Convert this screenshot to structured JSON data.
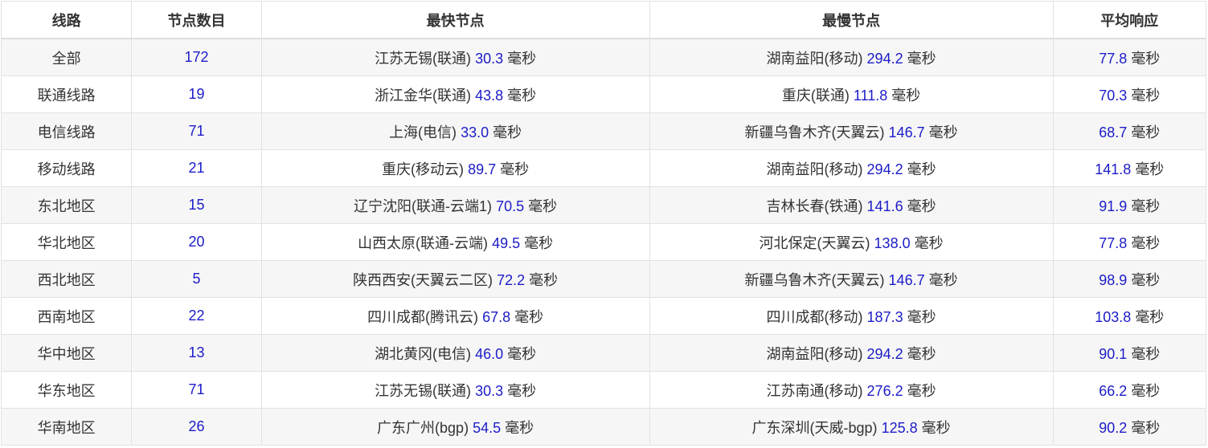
{
  "headers": {
    "line": "线路",
    "count": "节点数目",
    "fastest": "最快节点",
    "slowest": "最慢节点",
    "average": "平均响应"
  },
  "unit": "毫秒",
  "colors": {
    "number": "#1c1cc8",
    "text": "#333333",
    "row_alt": "#f6f6f6",
    "border": "#e2e2e2"
  },
  "rows": [
    {
      "line": "全部",
      "count": "172",
      "fast_name": "江苏无锡(联通)",
      "fast_ms": "30.3",
      "slow_name": "湖南益阳(移动)",
      "slow_ms": "294.2",
      "avg_ms": "77.8"
    },
    {
      "line": "联通线路",
      "count": "19",
      "fast_name": "浙江金华(联通)",
      "fast_ms": "43.8",
      "slow_name": "重庆(联通)",
      "slow_ms": "111.8",
      "avg_ms": "70.3"
    },
    {
      "line": "电信线路",
      "count": "71",
      "fast_name": "上海(电信)",
      "fast_ms": "33.0",
      "slow_name": "新疆乌鲁木齐(天翼云)",
      "slow_ms": "146.7",
      "avg_ms": "68.7"
    },
    {
      "line": "移动线路",
      "count": "21",
      "fast_name": "重庆(移动云)",
      "fast_ms": "89.7",
      "slow_name": "湖南益阳(移动)",
      "slow_ms": "294.2",
      "avg_ms": "141.8"
    },
    {
      "line": "东北地区",
      "count": "15",
      "fast_name": "辽宁沈阳(联通-云端1)",
      "fast_ms": "70.5",
      "slow_name": "吉林长春(铁通)",
      "slow_ms": "141.6",
      "avg_ms": "91.9"
    },
    {
      "line": "华北地区",
      "count": "20",
      "fast_name": "山西太原(联通-云端)",
      "fast_ms": "49.5",
      "slow_name": "河北保定(天翼云)",
      "slow_ms": "138.0",
      "avg_ms": "77.8"
    },
    {
      "line": "西北地区",
      "count": "5",
      "fast_name": "陕西西安(天翼云二区)",
      "fast_ms": "72.2",
      "slow_name": "新疆乌鲁木齐(天翼云)",
      "slow_ms": "146.7",
      "avg_ms": "98.9"
    },
    {
      "line": "西南地区",
      "count": "22",
      "fast_name": "四川成都(腾讯云)",
      "fast_ms": "67.8",
      "slow_name": "四川成都(移动)",
      "slow_ms": "187.3",
      "avg_ms": "103.8"
    },
    {
      "line": "华中地区",
      "count": "13",
      "fast_name": "湖北黄冈(电信)",
      "fast_ms": "46.0",
      "slow_name": "湖南益阳(移动)",
      "slow_ms": "294.2",
      "avg_ms": "90.1"
    },
    {
      "line": "华东地区",
      "count": "71",
      "fast_name": "江苏无锡(联通)",
      "fast_ms": "30.3",
      "slow_name": "江苏南通(移动)",
      "slow_ms": "276.2",
      "avg_ms": "66.2"
    },
    {
      "line": "华南地区",
      "count": "26",
      "fast_name": "广东广州(bgp)",
      "fast_ms": "54.5",
      "slow_name": "广东深圳(天威-bgp)",
      "slow_ms": "125.8",
      "avg_ms": "90.2"
    }
  ]
}
